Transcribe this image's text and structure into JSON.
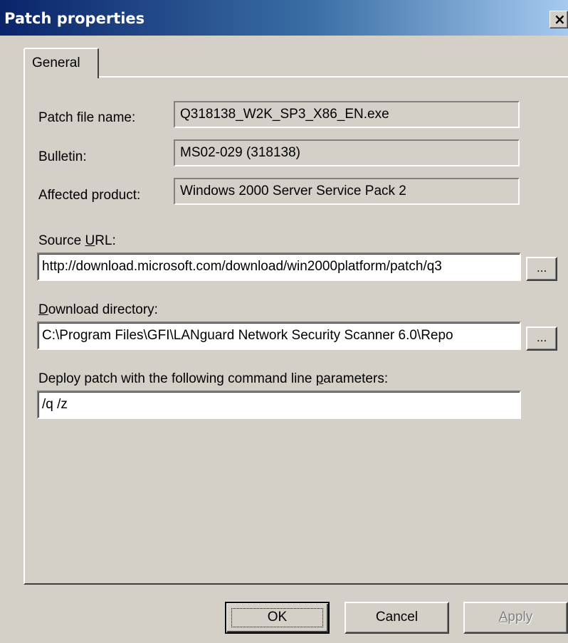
{
  "window": {
    "title": "Patch properties",
    "close_label": "×"
  },
  "tabs": [
    {
      "label": "General",
      "selected": true
    }
  ],
  "general": {
    "patch_file_name": {
      "label": "Patch file name:",
      "value": "Q318138_W2K_SP3_X86_EN.exe"
    },
    "bulletin": {
      "label": "Bulletin:",
      "value": "MS02-029 (318138)"
    },
    "affected_product": {
      "label": "Affected product:",
      "value": "Windows 2000 Server Service Pack 2"
    },
    "source_url": {
      "label_prefix": "Source ",
      "label_accel": "U",
      "label_suffix": "RL:",
      "value": "http://download.microsoft.com/download/win2000platform/patch/q3",
      "browse_label": "..."
    },
    "download_directory": {
      "label_prefix": "",
      "label_accel": "D",
      "label_suffix": "ownload directory:",
      "value": "C:\\Program Files\\GFI\\LANguard Network Security Scanner 6.0\\Repo",
      "browse_label": "..."
    },
    "command_line": {
      "label_prefix": "Deploy patch with the following command line ",
      "label_accel": "p",
      "label_suffix": "arameters:",
      "value": "/q /z"
    }
  },
  "buttons": {
    "ok": "OK",
    "cancel": "Cancel",
    "apply_accel": "A",
    "apply_suffix": "pply"
  },
  "colors": {
    "title_start": "#0a246a",
    "title_end": "#a6caf0",
    "face": "#d4d0c8"
  }
}
